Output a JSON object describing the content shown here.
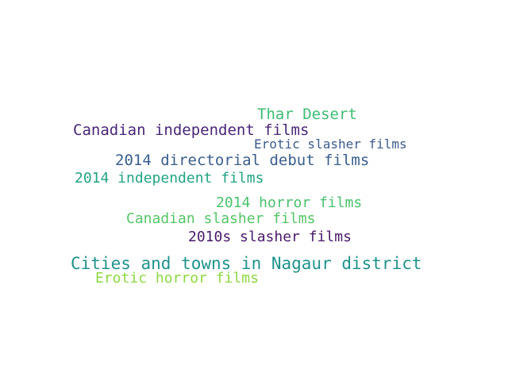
{
  "word_cloud": {
    "words": [
      {
        "text": "Thar Desert",
        "color": "#3fbc73"
      },
      {
        "text": "Canadian independent films",
        "color": "#482677"
      },
      {
        "text": "Erotic slasher films",
        "color": "#3b5b8c"
      },
      {
        "text": "2014 directorial debut films",
        "color": "#3a5e8c"
      },
      {
        "text": "2014 independent films",
        "color": "#22a384"
      },
      {
        "text": "2014 horror films",
        "color": "#4ac16d"
      },
      {
        "text": "Canadian slasher films",
        "color": "#55c667"
      },
      {
        "text": "2010s slasher films",
        "color": "#481a6c"
      },
      {
        "text": "Cities and towns in Nagaur district",
        "color": "#20928c"
      },
      {
        "text": "Erotic horror films",
        "color": "#8fd744"
      }
    ]
  }
}
